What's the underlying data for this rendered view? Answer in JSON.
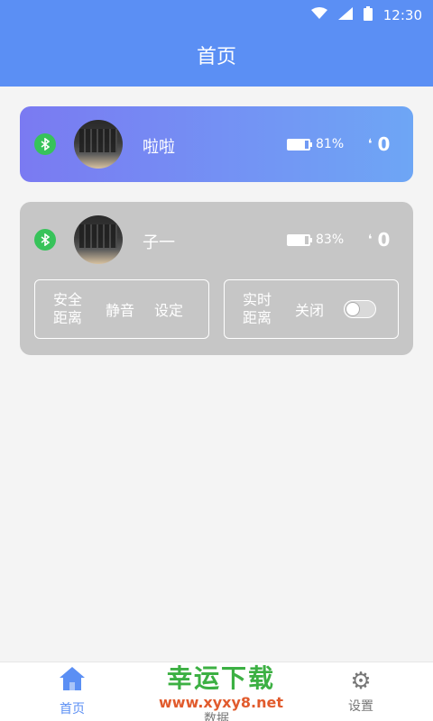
{
  "status_bar": {
    "time": "12:30"
  },
  "app_bar": {
    "title": "首页"
  },
  "cards": [
    {
      "name": "啦啦",
      "battery_text": "81%",
      "battery_level": 0.81,
      "steps": "0"
    },
    {
      "name": "子一",
      "battery_text": "83%",
      "battery_level": 0.83,
      "steps": "0",
      "safe_distance_label": "安全距离",
      "mute_label": "静音",
      "set_label": "设定",
      "realtime_distance_label": "实时距离",
      "off_label": "关闭"
    }
  ],
  "tabs": [
    {
      "label": "首页",
      "icon": "home-icon"
    },
    {
      "label": "数据",
      "icon": "data-icon"
    },
    {
      "label": "设置",
      "icon": "gear-icon"
    }
  ],
  "watermark": {
    "title": "幸运下载",
    "url": "www.xyxy8.net"
  },
  "colors": {
    "primary": "#5b8ff4",
    "bluetooth": "#37c35a",
    "card_gray": "#c6c6c6"
  }
}
